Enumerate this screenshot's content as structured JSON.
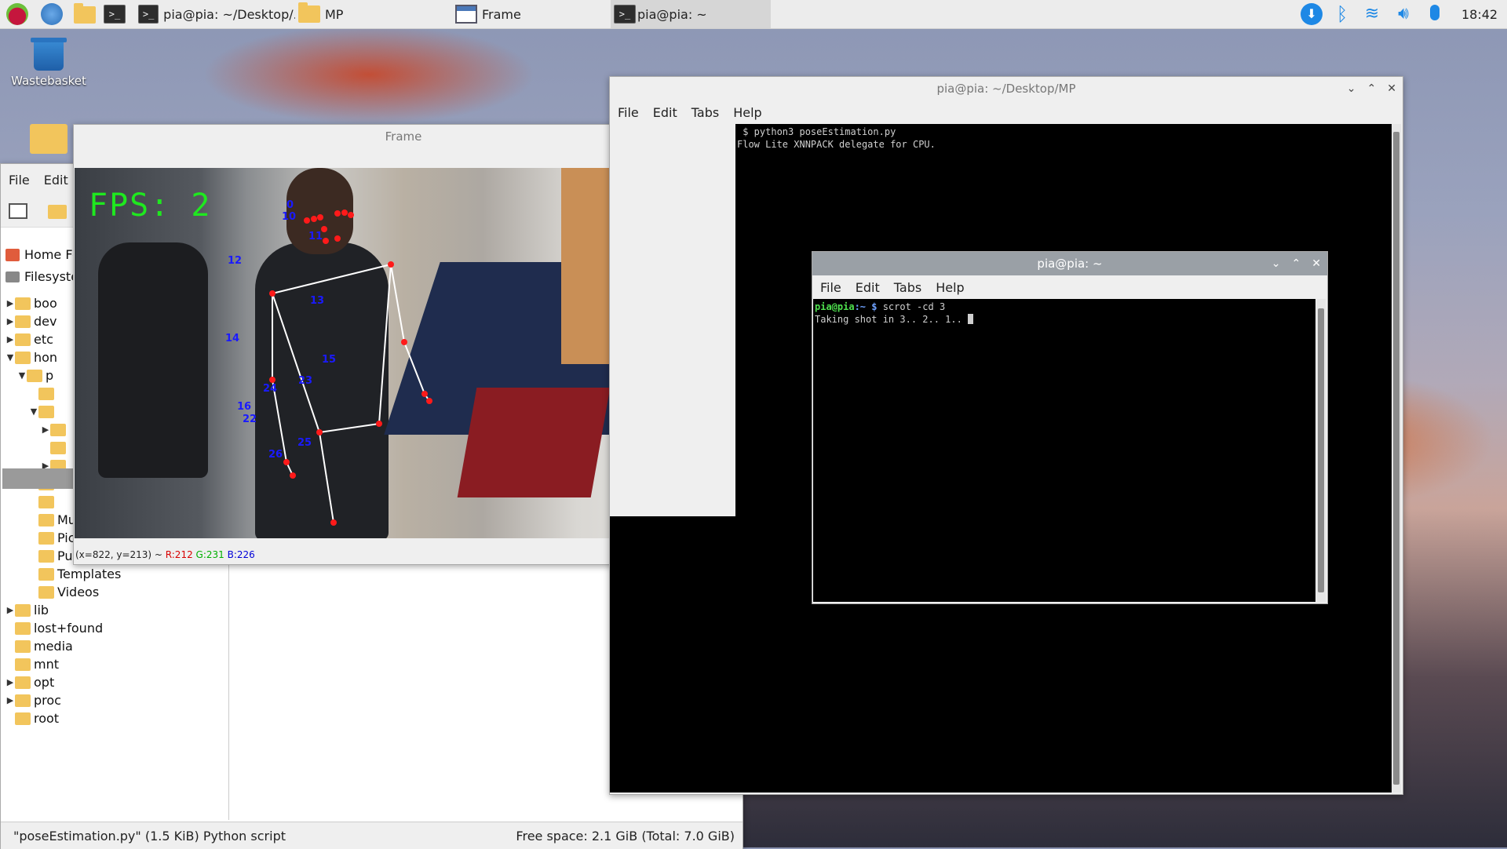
{
  "taskbar": {
    "items": [
      {
        "label": "pia@pia: ~/Desktop/...",
        "icon": "terminal-icon"
      },
      {
        "label": "MP",
        "icon": "folder-icon"
      },
      {
        "label": "Frame",
        "icon": "window-icon"
      },
      {
        "label": "pia@pia: ~",
        "icon": "terminal-icon"
      }
    ],
    "clock": "18:42",
    "tray_icons": [
      "download-icon",
      "bluetooth-icon",
      "wifi-icon",
      "volume-icon",
      "microphone-icon"
    ]
  },
  "desktop": {
    "icons": [
      {
        "label": "Wastebasket",
        "icon": "trash-icon"
      },
      {
        "label": "",
        "icon": "folder-icon"
      }
    ]
  },
  "filemanager": {
    "menu": [
      "File",
      "Edit"
    ],
    "places": [
      "Home Fo",
      "Filesyste"
    ],
    "tree": [
      {
        "label": "boo",
        "indent": 1,
        "expander": "▶"
      },
      {
        "label": "dev",
        "indent": 1,
        "expander": "▶"
      },
      {
        "label": "etc",
        "indent": 1,
        "expander": "▶"
      },
      {
        "label": "hon",
        "indent": 1,
        "expander": "▼"
      },
      {
        "label": "p",
        "indent": 2,
        "expander": "▼"
      },
      {
        "label": "",
        "indent": 3,
        "expander": ""
      },
      {
        "label": "",
        "indent": 3,
        "expander": "▼"
      },
      {
        "label": "",
        "indent": 4,
        "expander": "▶"
      },
      {
        "label": "",
        "indent": 4,
        "expander": ""
      },
      {
        "label": "",
        "indent": 4,
        "expander": "▶"
      },
      {
        "label": "",
        "indent": 3,
        "expander": ""
      },
      {
        "label": "",
        "indent": 3,
        "expander": ""
      },
      {
        "label": "Music",
        "indent": 3,
        "expander": ""
      },
      {
        "label": "Pictures",
        "indent": 3,
        "expander": ""
      },
      {
        "label": "Public",
        "indent": 3,
        "expander": ""
      },
      {
        "label": "Templates",
        "indent": 3,
        "expander": ""
      },
      {
        "label": "Videos",
        "indent": 3,
        "expander": ""
      },
      {
        "label": "lib",
        "indent": 1,
        "expander": "▶"
      },
      {
        "label": "lost+found",
        "indent": 1,
        "expander": ""
      },
      {
        "label": "media",
        "indent": 1,
        "expander": ""
      },
      {
        "label": "mnt",
        "indent": 1,
        "expander": ""
      },
      {
        "label": "opt",
        "indent": 1,
        "expander": "▶"
      },
      {
        "label": "proc",
        "indent": 1,
        "expander": "▶"
      },
      {
        "label": "root",
        "indent": 1,
        "expander": ""
      }
    ],
    "status_left": "\"poseEstimation.py\" (1.5 KiB) Python script",
    "status_right": "Free space: 2.1 GiB (Total: 7.0 GiB)"
  },
  "frame_window": {
    "title": "Frame",
    "fps_text": "FPS: 2",
    "status_coords": "(x=822, y=213) ~ ",
    "status_r": "R:212",
    "status_g": "G:231",
    "status_b": "B:226",
    "landmark_labels": [
      "0",
      "10",
      "11",
      "12",
      "13",
      "14",
      "15",
      "16",
      "22",
      "23",
      "24",
      "25",
      "26"
    ]
  },
  "terminal_mp": {
    "title": "pia@pia: ~/Desktop/MP",
    "menu": [
      "File",
      "Edit",
      "Tabs",
      "Help"
    ],
    "lines": [
      " $ python3 poseEstimation.py",
      "Flow Lite XNNPACK delegate for CPU."
    ]
  },
  "terminal_home": {
    "title": "pia@pia: ~",
    "menu": [
      "File",
      "Edit",
      "Tabs",
      "Help"
    ],
    "prompt_user": "pia@pia",
    "prompt_path": ":~ $ ",
    "command": "scrot -cd 3",
    "output": "Taking shot in 3.. 2.. 1.. "
  }
}
